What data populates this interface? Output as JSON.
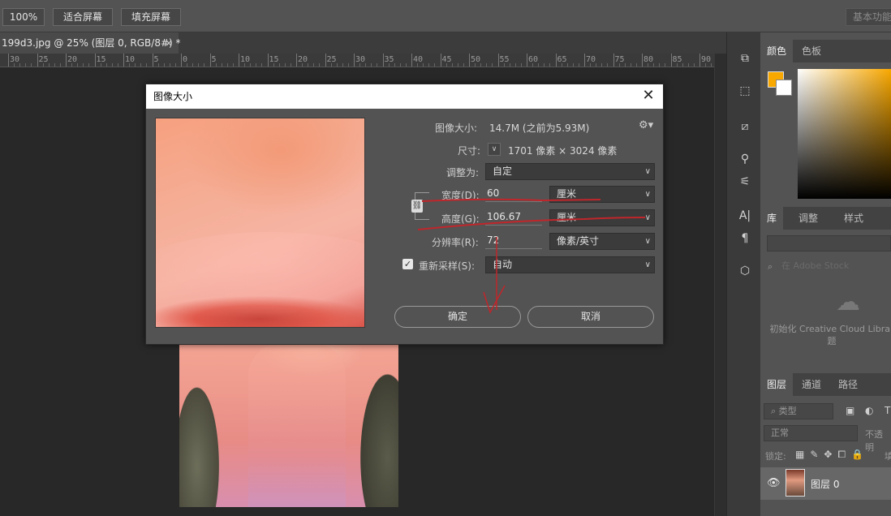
{
  "options_bar": {
    "zoom_btn": "100%",
    "fit_screen_btn": "适合屏幕",
    "fill_screen_btn": "填充屏幕",
    "workspace": "基本功能"
  },
  "document": {
    "tab_title": "199d3.jpg @ 25% (图层 0, RGB/8#) *",
    "tab_close": "×",
    "ruler_ticks": [
      "30",
      "25",
      "20",
      "15",
      "10",
      "5",
      "0",
      "5",
      "10",
      "15",
      "20",
      "25",
      "30",
      "35",
      "40",
      "45",
      "50",
      "55",
      "60",
      "65",
      "70",
      "75",
      "80",
      "85",
      "90"
    ]
  },
  "dialog": {
    "title": "图像大小",
    "close": "✕",
    "image_size_label": "图像大小:",
    "image_size_value": "14.7M (之前为5.93M)",
    "dimensions_label": "尺寸:",
    "dimensions_value": "1701 像素 × 3024 像素",
    "fit_to_label": "调整为:",
    "fit_to_value": "自定",
    "width_label": "宽度(D):",
    "width_value": "60",
    "width_unit": "厘米",
    "height_label": "高度(G):",
    "height_value": "106.67",
    "height_unit": "厘米",
    "resolution_label": "分辨率(R):",
    "resolution_value": "72",
    "resolution_unit": "像素/英寸",
    "resample_label": "重新采样(S):",
    "resample_value": "自动",
    "resample_checked": true,
    "ok_btn": "确定",
    "cancel_btn": "取消"
  },
  "panels": {
    "color_tabs": [
      "颜色",
      "色板"
    ],
    "foreground_color": "#f9a800",
    "background_color": "#ffffff",
    "library_tabs": [
      "库",
      "调整",
      "样式"
    ],
    "library_search_placeholder": "在 Adobe Stock",
    "cc_message": "初始化 Creative Cloud Librar 题",
    "layers_tabs": [
      "图层",
      "通道",
      "路径"
    ],
    "filter_kind": "类型",
    "blend_mode": "正常",
    "opacity_label": "不透明",
    "lock_label": "锁定:",
    "fill_label": "填",
    "layer_name": "图层 0"
  }
}
